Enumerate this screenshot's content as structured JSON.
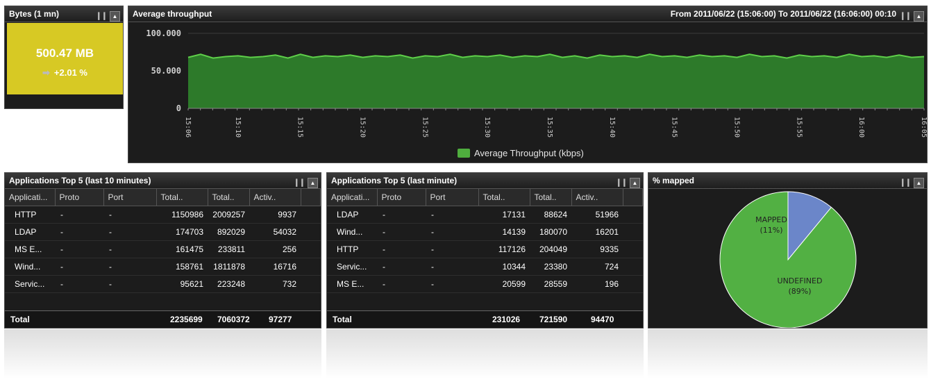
{
  "bytes_panel": {
    "title": "Bytes (1 mn)",
    "value": "500.47 MB",
    "change_arrow": "➡",
    "change": "+2.01 %"
  },
  "throughput_panel": {
    "title": "Average throughput",
    "range": "From 2011/06/22 (15:06:00) To 2011/06/22 (16:06:00)   00:10",
    "legend": "Average Throughput (kbps)"
  },
  "chart_data": {
    "type": "area",
    "ylim": [
      0,
      100000
    ],
    "yticks": [
      "100.000",
      "50.000",
      "0"
    ],
    "xticks": [
      "15:06",
      "15:10",
      "15:15",
      "15:20",
      "15:25",
      "15:30",
      "15:35",
      "15:40",
      "15:45",
      "15:50",
      "15:55",
      "16:00",
      "16:05"
    ],
    "series": [
      {
        "name": "Average Throughput (kbps)",
        "color": "#4fae3e",
        "values": [
          68000,
          72000,
          67000,
          69000,
          70000,
          68000,
          69000,
          71000,
          67000,
          72000,
          68000,
          70000,
          69000,
          71000,
          68000,
          70000,
          69000,
          71000,
          67000,
          70000,
          69000,
          72000,
          68000,
          70000,
          69000,
          71000,
          68000,
          70000,
          69000,
          72000,
          68000,
          70000,
          67000,
          71000,
          69000,
          70000,
          68000,
          72000,
          69000,
          70000,
          68000,
          71000,
          69000,
          70000,
          68000,
          72000,
          69000,
          70000,
          67000,
          71000,
          69000,
          70000,
          68000,
          72000,
          69000,
          70000,
          68000,
          71000,
          68000,
          69000
        ]
      }
    ]
  },
  "apps10": {
    "title": "Applications Top 5 (last 10 minutes)",
    "columns": [
      "Applicati...",
      "Proto",
      "Port",
      "Total..",
      "Total..",
      "Activ.."
    ],
    "rows": [
      [
        "HTTP",
        "-",
        "-",
        "1150986",
        "2009257",
        "9937"
      ],
      [
        "LDAP",
        "-",
        "-",
        "174703",
        "892029",
        "54032"
      ],
      [
        "MS E...",
        "-",
        "-",
        "161475",
        "233811",
        "256"
      ],
      [
        "Wind...",
        "-",
        "-",
        "158761",
        "1811878",
        "16716"
      ],
      [
        "Servic...",
        "-",
        "-",
        "95621",
        "223248",
        "732"
      ]
    ],
    "total": [
      "Total",
      "2235699",
      "7060372",
      "97277"
    ]
  },
  "apps1": {
    "title": "Applications Top 5 (last minute)",
    "columns": [
      "Applicati...",
      "Proto",
      "Port",
      "Total..",
      "Total..",
      "Activ.."
    ],
    "rows": [
      [
        "LDAP",
        "-",
        "-",
        "17131",
        "88624",
        "51966"
      ],
      [
        "Wind...",
        "-",
        "-",
        "14139",
        "180070",
        "16201"
      ],
      [
        "HTTP",
        "-",
        "-",
        "117126",
        "204049",
        "9335"
      ],
      [
        "Servic...",
        "-",
        "-",
        "10344",
        "23380",
        "724"
      ],
      [
        "MS E...",
        "-",
        "-",
        "20599",
        "28559",
        "196"
      ]
    ],
    "total": [
      "Total",
      "231026",
      "721590",
      "94470"
    ]
  },
  "mapped": {
    "title": "% mapped",
    "slices": [
      {
        "label": "MAPPED",
        "pct": "(11%)",
        "value": 11,
        "color": "#6b86c9"
      },
      {
        "label": "UNDEFINED",
        "pct": "(89%)",
        "value": 89,
        "color": "#52b043"
      }
    ]
  },
  "controls": {
    "pause": "❙❙",
    "collapse": "▲"
  }
}
